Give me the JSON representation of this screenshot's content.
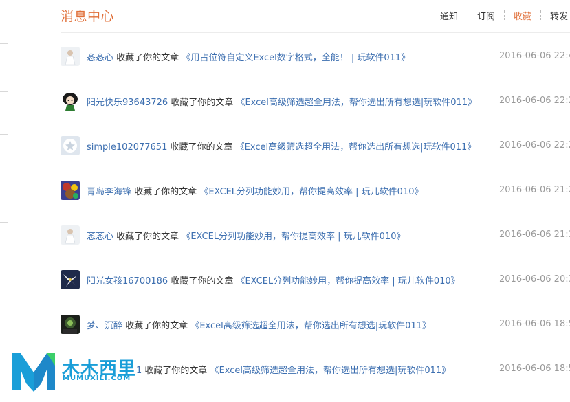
{
  "header": {
    "title": "消息中心",
    "tabs": [
      {
        "label": "通知",
        "active": false
      },
      {
        "label": "订阅",
        "active": false
      },
      {
        "label": "收藏",
        "active": true
      },
      {
        "label": "转发",
        "active": false
      }
    ]
  },
  "action_text": "收藏了你的文章",
  "messages": [
    {
      "user": "忞忞心",
      "article": "《用占位符自定义Excel数字格式，全能！ | 玩软件011》",
      "time": "2016-06-06 22:4",
      "avatar": "figure-white"
    },
    {
      "user": "阳光快乐93643726",
      "article": "《Excel高级筛选超全用法，帮你选出所有想选|玩软件011》",
      "time": "2016-06-06 22:2",
      "avatar": "cartoon-girl"
    },
    {
      "user": "simple102077651",
      "article": "《Excel高级筛选超全用法，帮你选出所有想选|玩软件011》",
      "time": "2016-06-06 22:2",
      "avatar": "default-star"
    },
    {
      "user": "青岛李海锋",
      "article": "《EXCEL分列功能妙用，帮你提高效率 | 玩儿软件010》",
      "time": "2016-06-06 21:2",
      "avatar": "colorful"
    },
    {
      "user": "忞忞心",
      "article": "《EXCEL分列功能妙用，帮你提高效率 | 玩儿软件010》",
      "time": "2016-06-06 21:1",
      "avatar": "figure-white"
    },
    {
      "user": "阳光女孩16700186",
      "article": "《EXCEL分列功能妙用，帮你提高效率 | 玩儿软件010》",
      "time": "2016-06-06 20:3",
      "avatar": "flower"
    },
    {
      "user": "梦、沉醉",
      "article": "《Excel高级筛选超全用法，帮你选出所有想选|玩软件011》",
      "time": "2016-06-06 18:5",
      "avatar": "dark-photo"
    },
    {
      "user": "1",
      "article": "《Excel高级筛选超全用法，帮你选出所有想选|玩软件011》",
      "time": "2016-06-06 18:5",
      "avatar": "hidden"
    }
  ],
  "watermark": {
    "cn": "木木西里",
    "en": "MUMUXILI.COM"
  },
  "colors": {
    "accent": "#e0703a",
    "link": "#3d6fb0",
    "muted": "#999999",
    "brand": "#1a9ed8"
  }
}
